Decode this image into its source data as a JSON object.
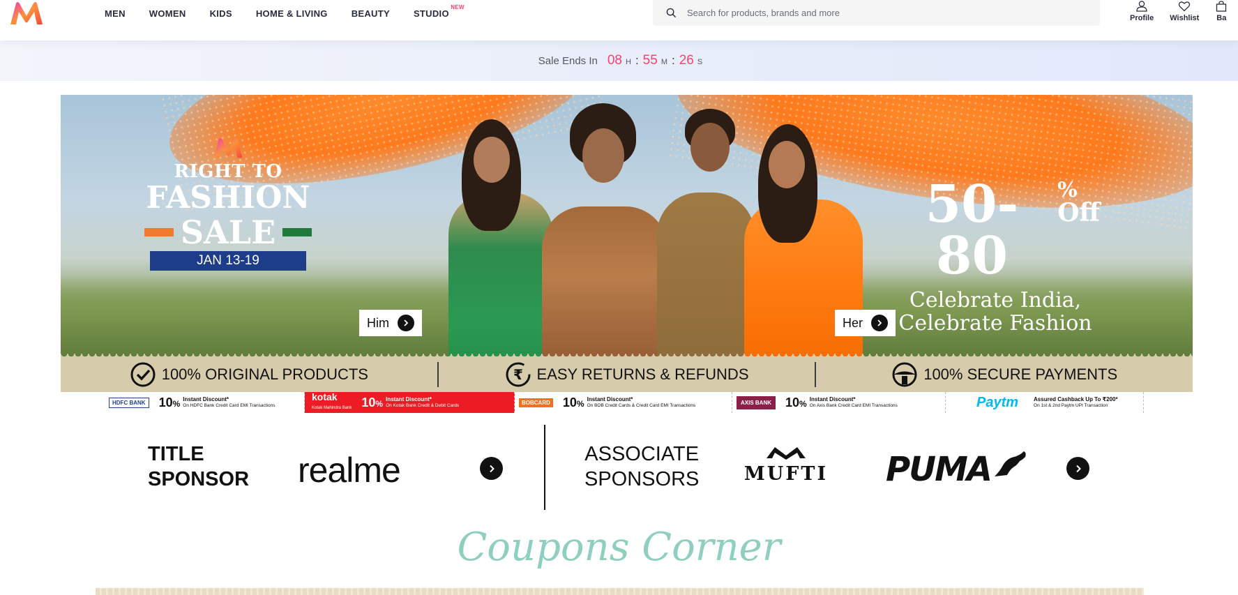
{
  "header": {
    "logo": "myntra-logo",
    "nav": [
      {
        "label": "MEN"
      },
      {
        "label": "WOMEN"
      },
      {
        "label": "KIDS"
      },
      {
        "label": "HOME & LIVING"
      },
      {
        "label": "BEAUTY"
      },
      {
        "label": "STUDIO",
        "badge": "NEW"
      }
    ],
    "search": {
      "placeholder": "Search for products, brands and more",
      "value": ""
    },
    "actions": [
      {
        "label": "Profile",
        "icon": "user-icon"
      },
      {
        "label": "Wishlist",
        "icon": "heart-icon"
      },
      {
        "label": "Ba",
        "icon": "bag-icon"
      }
    ]
  },
  "timer": {
    "label": "Sale Ends In",
    "hours": "08",
    "hours_unit": "H",
    "minutes": "55",
    "minutes_unit": "M",
    "seconds": "26",
    "seconds_unit": "S"
  },
  "banner": {
    "left": {
      "line1": "RIGHT TO",
      "line2": "FASHION",
      "line3": "SALE",
      "dates": "JAN 13-19"
    },
    "right": {
      "discount": "50-80",
      "pct": "%",
      "off": "Off",
      "tag1": "Celebrate India,",
      "tag2": "Celebrate Fashion"
    },
    "cta_him": "Him",
    "cta_her": "Her"
  },
  "trust": [
    {
      "label": "100% ORIGINAL PRODUCTS",
      "icon": "check-circle-icon"
    },
    {
      "label": "EASY RETURNS & REFUNDS",
      "icon": "rupee-circle-icon"
    },
    {
      "label": "100% SECURE PAYMENTS",
      "icon": "shield-lock-icon"
    }
  ],
  "bank_offers": [
    {
      "bank": "HDFC BANK",
      "pct": "10",
      "unit": "%",
      "t1": "Instant Discount*",
      "t2": "On HDFC Bank Credit Card EMI Transactions"
    },
    {
      "bank": "kotak",
      "sub": "Kotak Mahindra Bank",
      "pct": "10",
      "unit": "%",
      "t1": "Instant Discount*",
      "t2": "On Kotak Bank Credit & Debit Cards"
    },
    {
      "bank": "BOBCARD",
      "pct": "10",
      "unit": "%",
      "t1": "Instant Discount*",
      "t2": "On BOB Credit Cards & Credit Card EMI Transactions"
    },
    {
      "bank": "AXIS BANK",
      "pct": "10",
      "unit": "%",
      "t1": "Instant Discount*",
      "t2": "On Axis Bank Credit Card EMI Transactions"
    },
    {
      "bank": "Paytm",
      "t1": "Assured Cashback Up To ₹200*",
      "t2": "On 1st & 2nd Paytm UPI Transaction"
    }
  ],
  "sponsors": {
    "title_l1": "TITLE",
    "title_l2": "SPONSOR",
    "title_brand": "realme",
    "assoc_l1": "ASSOCIATE",
    "assoc_l2": "SPONSORS",
    "assoc_brand1": "MUFTI",
    "assoc_brand2": "PUMA"
  },
  "coupons_title": "Coupons Corner",
  "colors": {
    "accent": "#ff3f6c",
    "trust_bg": "#d6cbaa",
    "coupon_title": "#8fcfbf",
    "bank_kotak": "#ed1c24"
  }
}
